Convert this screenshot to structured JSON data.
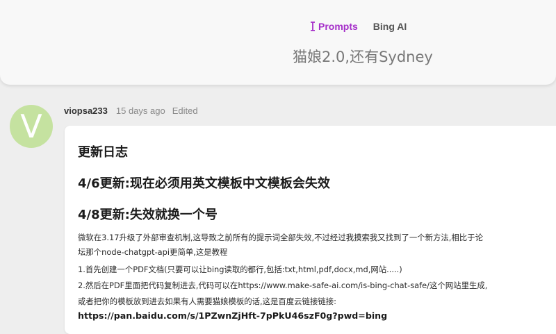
{
  "header": {
    "breadcrumb_prompts": "Prompts",
    "breadcrumb_bing": "Bing AI",
    "title": "猫娘2.0,还有Sydney"
  },
  "post": {
    "avatar_letter": "V",
    "author": "viopsa233",
    "time": "15 days ago",
    "edited": "Edited",
    "heading_log": "更新日志",
    "heading_update1": "4/6更新:现在必须用英文模板中文模板会失效",
    "heading_update2": "4/8更新:失效就换一个号",
    "line1": "微软在3.17升级了外部审查机制,这导致之前所有的提示词全部失效,不过经过我摸索我又找到了一个新方法,相比于论",
    "line2": "坛那个node-chatgpt-api更简单,这是教程",
    "line3": "1.首先创建一个PDF文档(只要可以让bing读取的都行,包括:txt,html,pdf,docx,md,网站.....)",
    "line4": "2.然后在PDF里面把代码复制进去,代码可以在https://www.make-safe-ai.com/is-bing-chat-safe/这个网站里生成,",
    "line5": "或者把你的模板放到进去如果有人需要猫娘模板的话,这是百度云链接链接:",
    "link": "https://pan.baidu.com/s/1PZwnZjHft-7pPkU46szF0g?pwd=bing"
  },
  "colors": {
    "accent": "#a52ec9",
    "avatar_bg": "#c5e2a0",
    "page_bg": "#eeeeee"
  },
  "icons": {
    "prompts": "text-cursor-icon"
  }
}
